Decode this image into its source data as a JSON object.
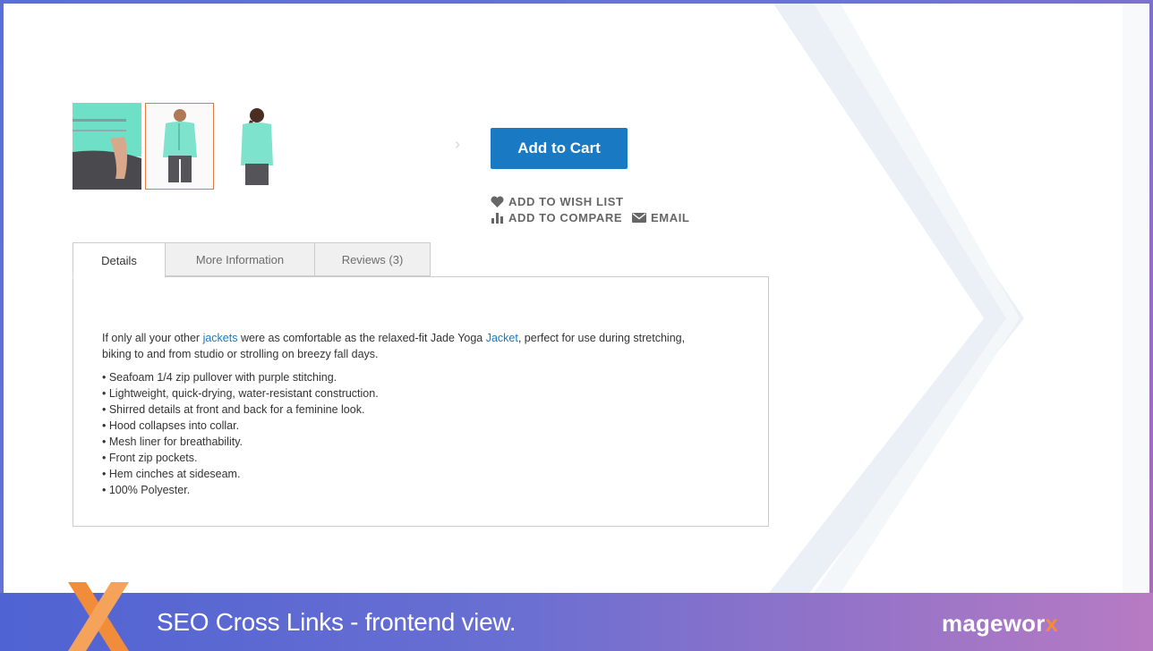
{
  "product": {
    "gallery": {
      "thumbnails": [
        "thumbnail-detail",
        "thumbnail-front",
        "thumbnail-back"
      ],
      "selected_index": 1
    },
    "add_to_cart_label": "Add to Cart",
    "actions": {
      "wish_list": "ADD TO WISH LIST",
      "compare": "ADD TO COMPARE",
      "email": "EMAIL"
    }
  },
  "tabs": [
    {
      "label": "Details",
      "active": true
    },
    {
      "label": "More Information",
      "active": false
    },
    {
      "label": "Reviews (3)",
      "active": false
    }
  ],
  "details": {
    "intro_1": "If only all your other ",
    "link_1": "jackets",
    "intro_2": " were as comfortable as the relaxed-fit Jade Yoga ",
    "link_2": "Jacket",
    "intro_3": ", perfect for use during stretching,",
    "intro_4": "biking to and from studio or strolling on breezy fall days.",
    "features": [
      "• Seafoam 1/4 zip pullover with purple stitching.",
      "• Lightweight, quick-drying, water-resistant construction.",
      "• Shirred details at front and back for a feminine look.",
      "• Hood collapses into collar.",
      "• Mesh liner for breathability.",
      "• Front zip pockets.",
      "• Hem cinches at sideseam.",
      "• 100% Polyester."
    ]
  },
  "footer": {
    "title": "SEO Cross Links - frontend view.",
    "brand_main": "magewor",
    "brand_x": "x"
  },
  "colors": {
    "button": "#1979c3",
    "link": "#1979c3",
    "selected_thumb_border": "#e27a3f",
    "accent_orange": "#f08c3a"
  }
}
